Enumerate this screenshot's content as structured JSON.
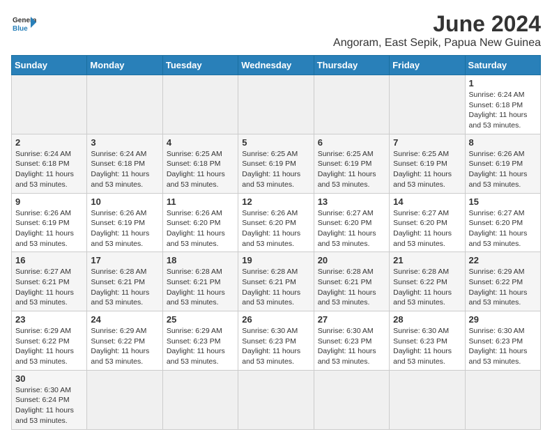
{
  "header": {
    "logo_general": "General",
    "logo_blue": "Blue",
    "month_title": "June 2024",
    "subtitle": "Angoram, East Sepik, Papua New Guinea"
  },
  "days_of_week": [
    "Sunday",
    "Monday",
    "Tuesday",
    "Wednesday",
    "Thursday",
    "Friday",
    "Saturday"
  ],
  "weeks": [
    {
      "days": [
        {
          "num": "",
          "empty": true
        },
        {
          "num": "",
          "empty": true
        },
        {
          "num": "",
          "empty": true
        },
        {
          "num": "",
          "empty": true
        },
        {
          "num": "",
          "empty": true
        },
        {
          "num": "",
          "empty": true
        },
        {
          "num": "1",
          "sunrise": "6:24 AM",
          "sunset": "6:18 PM",
          "daylight": "11 hours and 53 minutes."
        }
      ]
    },
    {
      "days": [
        {
          "num": "2",
          "sunrise": "6:24 AM",
          "sunset": "6:18 PM",
          "daylight": "11 hours and 53 minutes."
        },
        {
          "num": "3",
          "sunrise": "6:24 AM",
          "sunset": "6:18 PM",
          "daylight": "11 hours and 53 minutes."
        },
        {
          "num": "4",
          "sunrise": "6:25 AM",
          "sunset": "6:18 PM",
          "daylight": "11 hours and 53 minutes."
        },
        {
          "num": "5",
          "sunrise": "6:25 AM",
          "sunset": "6:19 PM",
          "daylight": "11 hours and 53 minutes."
        },
        {
          "num": "6",
          "sunrise": "6:25 AM",
          "sunset": "6:19 PM",
          "daylight": "11 hours and 53 minutes."
        },
        {
          "num": "7",
          "sunrise": "6:25 AM",
          "sunset": "6:19 PM",
          "daylight": "11 hours and 53 minutes."
        },
        {
          "num": "8",
          "sunrise": "6:26 AM",
          "sunset": "6:19 PM",
          "daylight": "11 hours and 53 minutes."
        }
      ]
    },
    {
      "days": [
        {
          "num": "9",
          "sunrise": "6:26 AM",
          "sunset": "6:19 PM",
          "daylight": "11 hours and 53 minutes."
        },
        {
          "num": "10",
          "sunrise": "6:26 AM",
          "sunset": "6:19 PM",
          "daylight": "11 hours and 53 minutes."
        },
        {
          "num": "11",
          "sunrise": "6:26 AM",
          "sunset": "6:20 PM",
          "daylight": "11 hours and 53 minutes."
        },
        {
          "num": "12",
          "sunrise": "6:26 AM",
          "sunset": "6:20 PM",
          "daylight": "11 hours and 53 minutes."
        },
        {
          "num": "13",
          "sunrise": "6:27 AM",
          "sunset": "6:20 PM",
          "daylight": "11 hours and 53 minutes."
        },
        {
          "num": "14",
          "sunrise": "6:27 AM",
          "sunset": "6:20 PM",
          "daylight": "11 hours and 53 minutes."
        },
        {
          "num": "15",
          "sunrise": "6:27 AM",
          "sunset": "6:20 PM",
          "daylight": "11 hours and 53 minutes."
        }
      ]
    },
    {
      "days": [
        {
          "num": "16",
          "sunrise": "6:27 AM",
          "sunset": "6:21 PM",
          "daylight": "11 hours and 53 minutes."
        },
        {
          "num": "17",
          "sunrise": "6:28 AM",
          "sunset": "6:21 PM",
          "daylight": "11 hours and 53 minutes."
        },
        {
          "num": "18",
          "sunrise": "6:28 AM",
          "sunset": "6:21 PM",
          "daylight": "11 hours and 53 minutes."
        },
        {
          "num": "19",
          "sunrise": "6:28 AM",
          "sunset": "6:21 PM",
          "daylight": "11 hours and 53 minutes."
        },
        {
          "num": "20",
          "sunrise": "6:28 AM",
          "sunset": "6:21 PM",
          "daylight": "11 hours and 53 minutes."
        },
        {
          "num": "21",
          "sunrise": "6:28 AM",
          "sunset": "6:22 PM",
          "daylight": "11 hours and 53 minutes."
        },
        {
          "num": "22",
          "sunrise": "6:29 AM",
          "sunset": "6:22 PM",
          "daylight": "11 hours and 53 minutes."
        }
      ]
    },
    {
      "days": [
        {
          "num": "23",
          "sunrise": "6:29 AM",
          "sunset": "6:22 PM",
          "daylight": "11 hours and 53 minutes."
        },
        {
          "num": "24",
          "sunrise": "6:29 AM",
          "sunset": "6:22 PM",
          "daylight": "11 hours and 53 minutes."
        },
        {
          "num": "25",
          "sunrise": "6:29 AM",
          "sunset": "6:23 PM",
          "daylight": "11 hours and 53 minutes."
        },
        {
          "num": "26",
          "sunrise": "6:30 AM",
          "sunset": "6:23 PM",
          "daylight": "11 hours and 53 minutes."
        },
        {
          "num": "27",
          "sunrise": "6:30 AM",
          "sunset": "6:23 PM",
          "daylight": "11 hours and 53 minutes."
        },
        {
          "num": "28",
          "sunrise": "6:30 AM",
          "sunset": "6:23 PM",
          "daylight": "11 hours and 53 minutes."
        },
        {
          "num": "29",
          "sunrise": "6:30 AM",
          "sunset": "6:23 PM",
          "daylight": "11 hours and 53 minutes."
        }
      ]
    },
    {
      "days": [
        {
          "num": "30",
          "sunrise": "6:30 AM",
          "sunset": "6:24 PM",
          "daylight": "11 hours and 53 minutes."
        },
        {
          "num": "",
          "empty": true
        },
        {
          "num": "",
          "empty": true
        },
        {
          "num": "",
          "empty": true
        },
        {
          "num": "",
          "empty": true
        },
        {
          "num": "",
          "empty": true
        },
        {
          "num": "",
          "empty": true
        }
      ]
    }
  ]
}
